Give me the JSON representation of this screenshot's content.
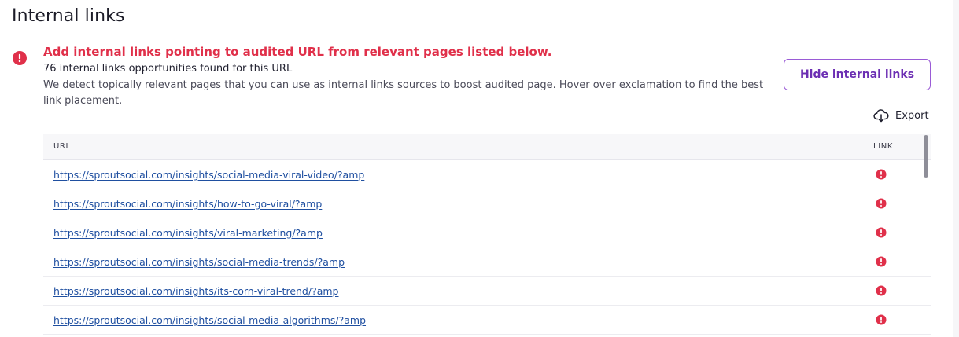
{
  "page": {
    "title": "Internal links"
  },
  "alert": {
    "icon": "exclamation-circle-icon",
    "headline": "Add internal links pointing to audited URL from relevant pages listed below.",
    "count_text": "76 internal links opportunities found for this URL",
    "description": "We detect topically relevant pages that you can use as internal links sources to boost audited page. Hover over exclamation to find the best link placement."
  },
  "actions": {
    "hide_label": "Hide internal links",
    "export_label": "Export",
    "export_icon": "cloud-download-icon"
  },
  "table": {
    "columns": [
      "URL",
      "LINK"
    ],
    "rows": [
      {
        "url": "https://sproutsocial.com/insights/social-media-viral-video/?amp"
      },
      {
        "url": "https://sproutsocial.com/insights/how-to-go-viral/?amp"
      },
      {
        "url": "https://sproutsocial.com/insights/viral-marketing/?amp"
      },
      {
        "url": "https://sproutsocial.com/insights/social-media-trends/?amp"
      },
      {
        "url": "https://sproutsocial.com/insights/its-corn-viral-trend/?amp"
      },
      {
        "url": "https://sproutsocial.com/insights/social-media-algorithms/?amp"
      }
    ],
    "link_icon": "exclamation-circle-icon"
  },
  "colors": {
    "alert": "#e0304a",
    "accent": "#6c2fb3",
    "link": "#1f4fa0"
  }
}
